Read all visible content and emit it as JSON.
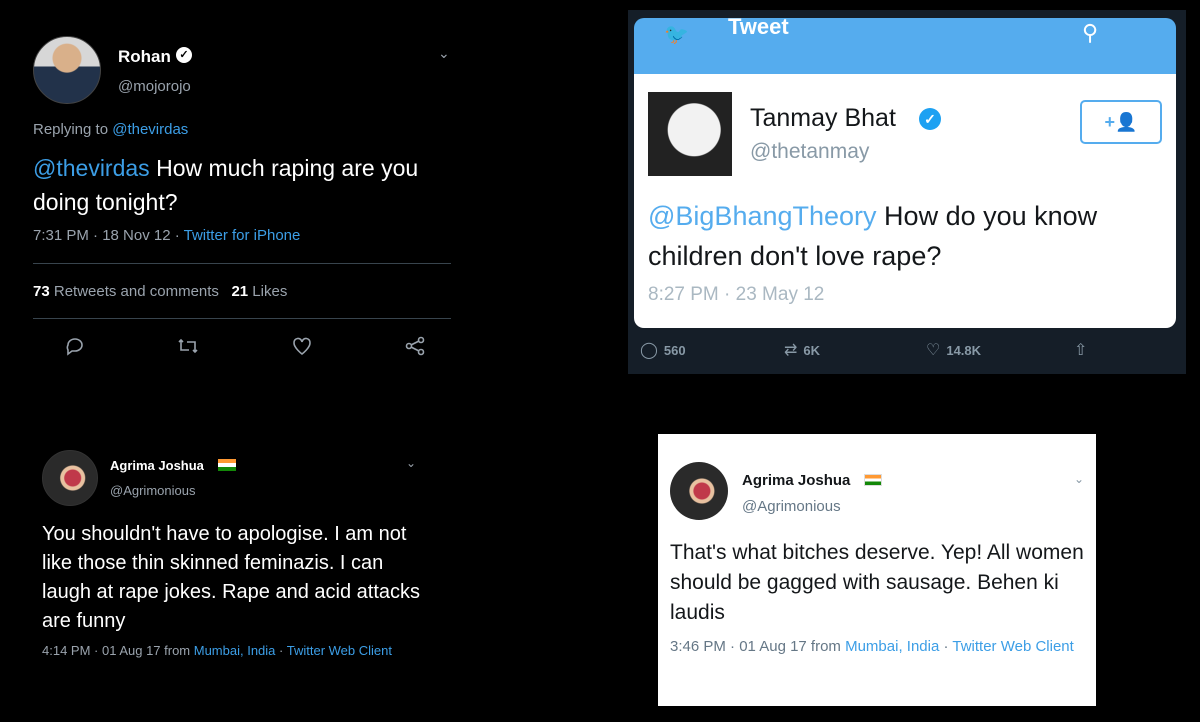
{
  "tweet1": {
    "name": "Rohan",
    "handle": "@mojorojo",
    "replying_prefix": "Replying to ",
    "replying_to": "@thevirdas",
    "mention": "@thevirdas",
    "text": " How much raping are you doing tonight?",
    "time": "7:31 PM · 18 Nov 12 · ",
    "source": "Twitter for iPhone",
    "retweets_count": "73",
    "retweets_label": " Retweets and comments",
    "likes_count": "21",
    "likes_label": " Likes",
    "icons": [
      "reply-icon",
      "retweet-icon",
      "like-icon",
      "share-icon"
    ]
  },
  "tweet2": {
    "bar_title": "Tweet",
    "name": "Tanmay Bhat",
    "handle": "@thetanmay",
    "follow_label": "+👤",
    "mention": "@BigBhangTheory",
    "text": " How do you know children don't love rape?",
    "time": "8:27 PM · 23 May 12",
    "replies": "560",
    "retweets": "6K",
    "likes": "14.8K"
  },
  "tweet3": {
    "name": "Agrima Joshua",
    "handle": "@Agrimonious",
    "text": "You shouldn't have to apologise. I am not like those thin skinned feminazis. I can laugh at rape jokes. Rape and acid attacks are funny",
    "time": "4:14 PM · 01 Aug 17 from ",
    "location": "Mumbai, India",
    "sep": " · ",
    "source": "Twitter Web Client"
  },
  "tweet4": {
    "name": "Agrima Joshua",
    "handle": "@Agrimonious",
    "text": "That's what bitches deserve. Yep! All women should be gagged with sausage. Behen ki laudis",
    "time": "3:46 PM · 01 Aug 17 from ",
    "location": "Mumbai, India",
    "sep": " · ",
    "source": "Twitter Web Client"
  },
  "colors": {
    "link": "#3c9ee6",
    "twitter_blue": "#55acee",
    "verified": "#1da1f2"
  }
}
